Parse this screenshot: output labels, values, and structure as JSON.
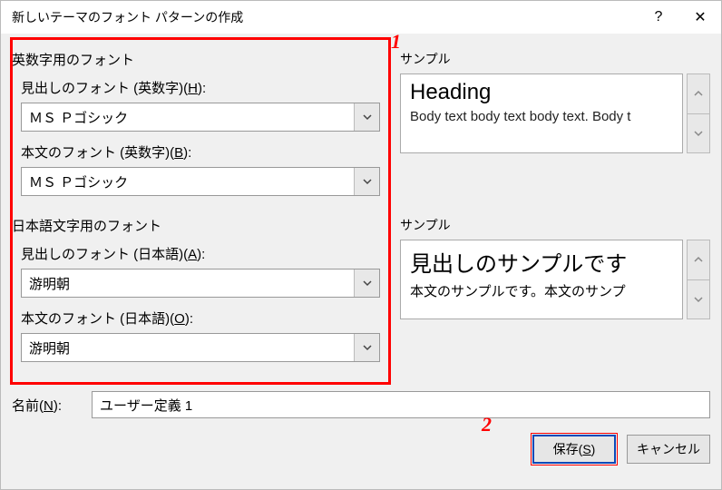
{
  "title": "新しいテーマのフォント パターンの作成",
  "annotations": {
    "n1": "1",
    "n2": "2"
  },
  "latin": {
    "group": "英数字用のフォント",
    "heading_label_pre": "見出しのフォント (英数字)(",
    "heading_label_key": "H",
    "heading_label_post": "):",
    "heading_value": "ＭＳ Ｐゴシック",
    "body_label_pre": "本文のフォント (英数字)(",
    "body_label_key": "B",
    "body_label_post": "):",
    "body_value": "ＭＳ Ｐゴシック"
  },
  "jp": {
    "group": "日本語文字用のフォント",
    "heading_label_pre": "見出しのフォント (日本語)(",
    "heading_label_key": "A",
    "heading_label_post": "):",
    "heading_value": "游明朝",
    "body_label_pre": "本文のフォント (日本語)(",
    "body_label_key": "O",
    "body_label_post": "):",
    "body_value": "游明朝"
  },
  "sample": {
    "label": "サンプル",
    "latin_heading": "Heading",
    "latin_body": "Body text body text body text. Body t",
    "jp_heading": "見出しのサンプルです",
    "jp_body": "本文のサンプルです。本文のサンプ"
  },
  "name": {
    "label_pre": "名前(",
    "label_key": "N",
    "label_post": "):",
    "value": "ユーザー定義 1"
  },
  "buttons": {
    "save_pre": "保存(",
    "save_key": "S",
    "save_post": ")",
    "cancel": "キャンセル"
  }
}
